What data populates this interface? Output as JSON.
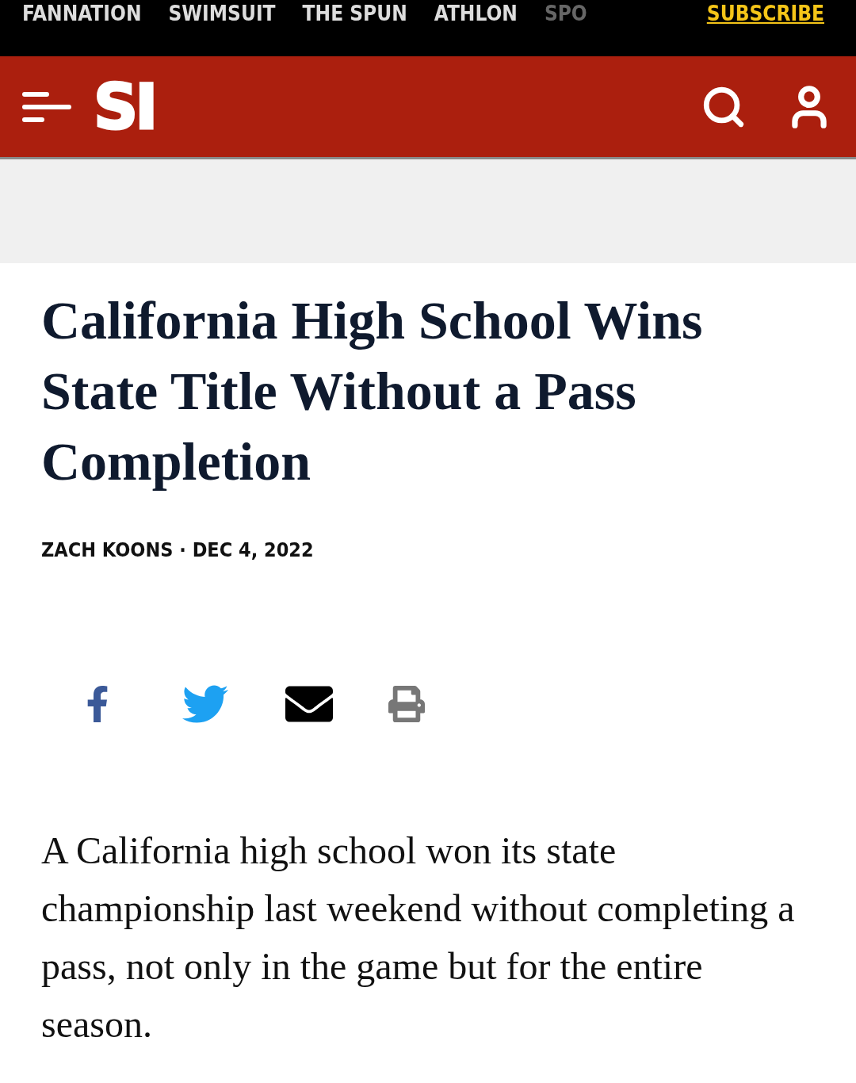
{
  "top_nav": {
    "links": [
      {
        "label": "FANNATION",
        "kind": "link"
      },
      {
        "label": "SWIMSUIT",
        "kind": "link"
      },
      {
        "label": "THE SPUN",
        "kind": "link"
      },
      {
        "label": "ATHLON",
        "kind": "link"
      },
      {
        "label": "SPO",
        "kind": "faded"
      }
    ],
    "subscribe": "SUBSCRIBE"
  },
  "header": {
    "logo": "SI"
  },
  "article": {
    "title": "California High School Wins State Title Without a Pass Completion",
    "byline": "ZACH KOONS · DEC 4, 2022",
    "share": [
      {
        "kind": "facebook"
      },
      {
        "kind": "twitter"
      },
      {
        "kind": "email"
      },
      {
        "kind": "print"
      }
    ],
    "body": "A California high school won its state championship last weekend without completing a pass, not only in the game but for the entire season."
  }
}
